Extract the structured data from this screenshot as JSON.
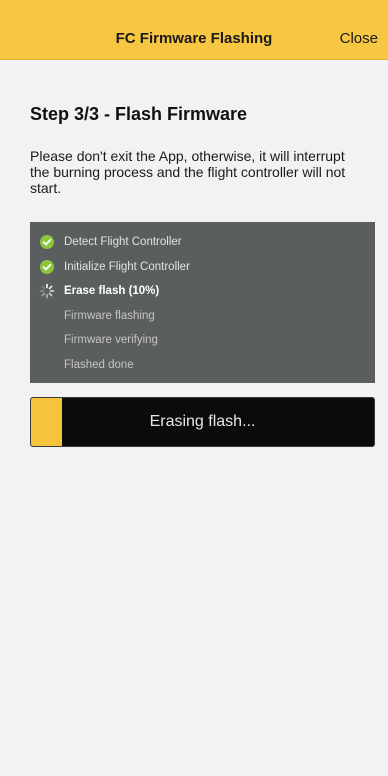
{
  "header": {
    "title": "FC Firmware Flashing",
    "close_label": "Close",
    "bg_color": "#f7c643"
  },
  "main": {
    "step_title": "Step 3/3 - Flash Firmware",
    "warning": "Please don't exit the App, otherwise, it will interrupt the burning process and the flight controller will not start."
  },
  "steps": [
    {
      "label": "Detect Flight Controller",
      "status": "done",
      "icon": "check-circle-icon"
    },
    {
      "label": "Initialize Flight Controller",
      "status": "done",
      "icon": "check-circle-icon"
    },
    {
      "label": "Erase flash (10%)",
      "status": "active",
      "icon": "spinner-icon"
    },
    {
      "label": "Firmware flashing",
      "status": "pending",
      "icon": ""
    },
    {
      "label": "Firmware verifying",
      "status": "pending",
      "icon": ""
    },
    {
      "label": "Flashed done",
      "status": "pending",
      "icon": ""
    }
  ],
  "progress": {
    "label": "Erasing flash...",
    "value": 0.09,
    "fill_color": "#f6c33d",
    "check_color": "#8cc63f"
  }
}
